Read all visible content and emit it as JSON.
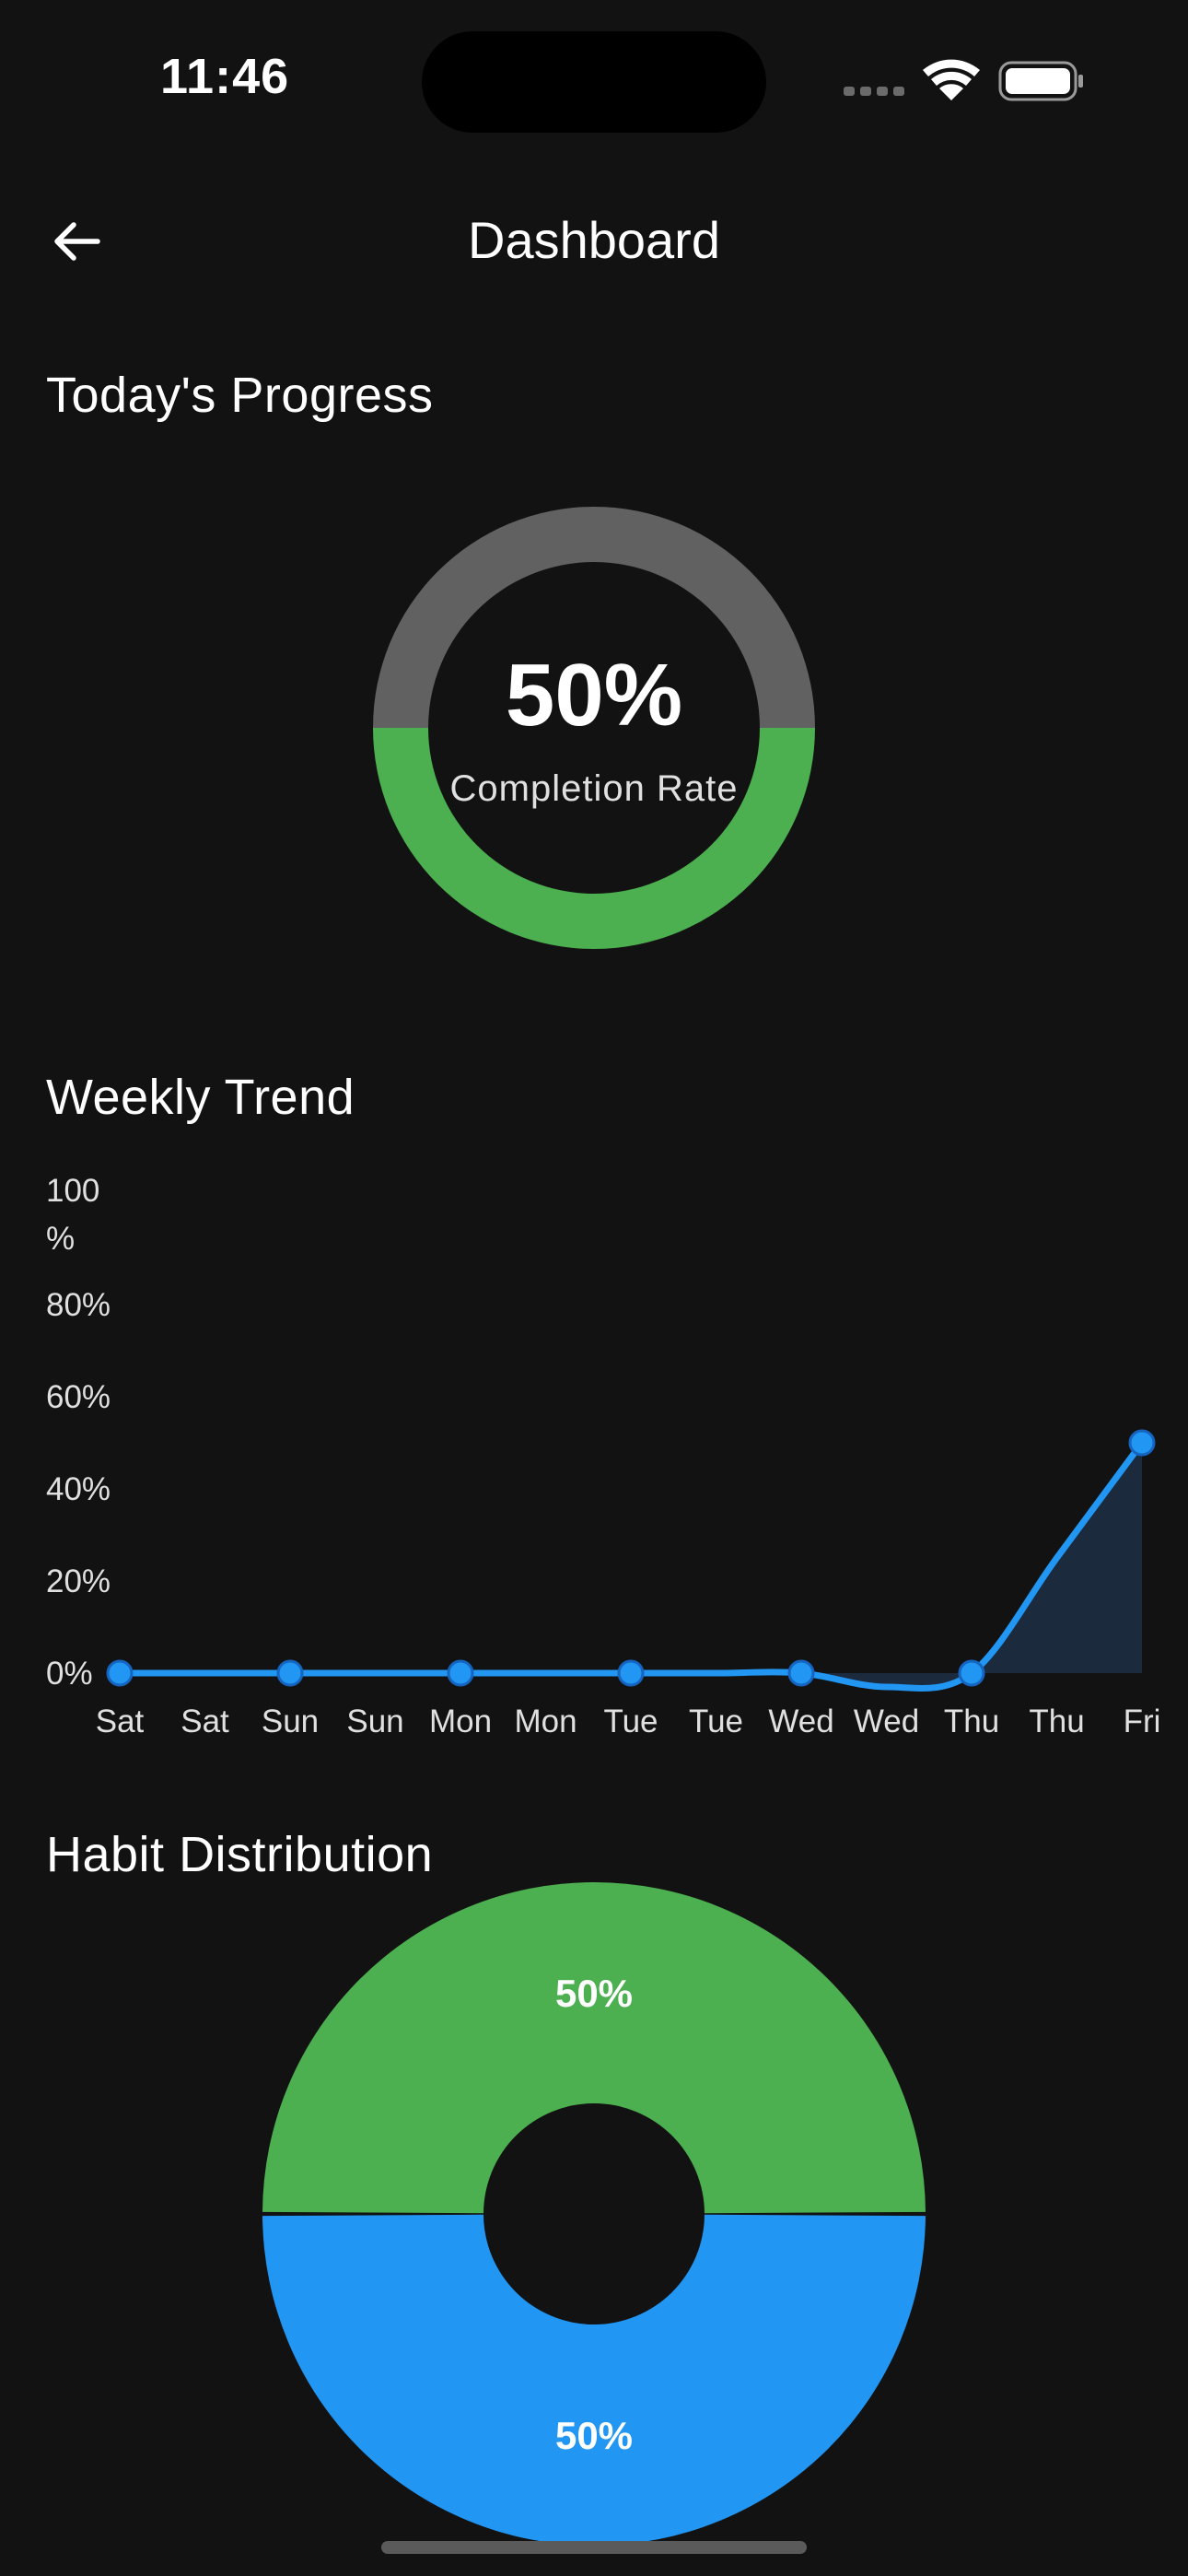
{
  "status_bar": {
    "time": "11:46"
  },
  "header": {
    "title": "Dashboard",
    "back_icon": "arrow-left-icon"
  },
  "progress": {
    "section_title": "Today's Progress",
    "value_text": "50%",
    "label": "Completion Rate",
    "completed_fraction": 0.5,
    "completed_color": "#4CAF50",
    "remaining_color": "#616161"
  },
  "trend": {
    "section_title": "Weekly Trend",
    "line_color": "#2196F3",
    "fill_color": "#1B2A3C"
  },
  "distribution": {
    "section_title": "Habit Distribution"
  },
  "chart_data": [
    {
      "type": "line",
      "title": "Weekly Trend",
      "x": [
        "Sat",
        "Sat",
        "Sun",
        "Sun",
        "Mon",
        "Mon",
        "Tue",
        "Tue",
        "Wed",
        "Wed",
        "Thu",
        "Thu",
        "Fri"
      ],
      "marker_indices": [
        0,
        2,
        4,
        6,
        8,
        10,
        12
      ],
      "series": [
        {
          "values": [
            0,
            0,
            0,
            0,
            0,
            0,
            0,
            0,
            0,
            -3,
            0,
            25,
            50
          ]
        }
      ],
      "yticks": [
        "0%",
        "20%",
        "40%",
        "60%",
        "80%",
        "100\n%"
      ],
      "ylim": [
        0,
        100
      ],
      "grid": false
    },
    {
      "type": "pie",
      "title": "Habit Distribution",
      "slices": [
        {
          "label": "50%",
          "value": 50,
          "color": "#4CAF50"
        },
        {
          "label": "50%",
          "value": 50,
          "color": "#2196F3"
        }
      ],
      "donut": true
    }
  ]
}
